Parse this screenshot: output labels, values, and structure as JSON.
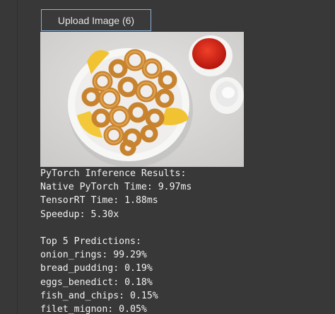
{
  "upload": {
    "label": "Upload Image (6)"
  },
  "image": {
    "subject": "fried-calamari-plate"
  },
  "results": {
    "heading": "PyTorch Inference Results:",
    "native_time": "Native PyTorch Time: 9.97ms",
    "tensorrt_time": "TensorRT Time: 1.88ms",
    "speedup": "Speedup: 5.30x",
    "predictions_heading": "Top 5 Predictions:",
    "predictions": [
      "onion_rings: 99.29%",
      "bread_pudding: 0.19%",
      "eggs_benedict: 0.18%",
      "fish_and_chips: 0.15%",
      "filet_mignon: 0.05%"
    ]
  },
  "colors": {
    "background": "#383838",
    "button_border": "#8ab2d6",
    "text": "#f2f2f2"
  }
}
